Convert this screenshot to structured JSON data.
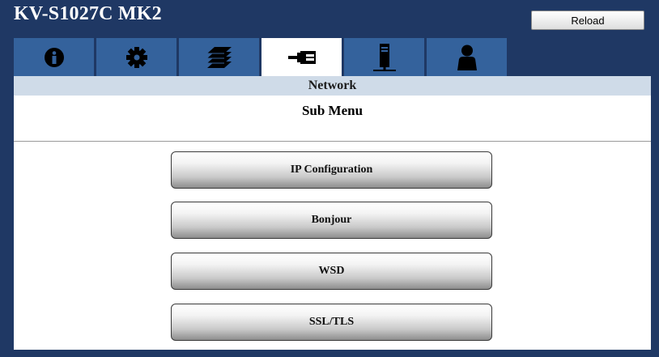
{
  "app": {
    "title": "KV-S1027C MK2"
  },
  "header": {
    "reload_label": "Reload"
  },
  "tabs": [
    {
      "icon": "info-icon",
      "active": false
    },
    {
      "icon": "gear-icon",
      "active": false
    },
    {
      "icon": "paper-stack-icon",
      "active": false
    },
    {
      "icon": "network-plug-icon",
      "active": true
    },
    {
      "icon": "server-tower-icon",
      "active": false
    },
    {
      "icon": "user-icon",
      "active": false
    }
  ],
  "section": {
    "title": "Network"
  },
  "submenu": {
    "title": "Sub Menu",
    "items": [
      {
        "label": "IP Configuration"
      },
      {
        "label": "Bonjour"
      },
      {
        "label": "WSD"
      },
      {
        "label": "SSL/TLS"
      }
    ]
  },
  "colors": {
    "frame": "#1f3864",
    "tab": "#34629c",
    "tab_active": "#ffffff",
    "section_bar": "#cfdbe8"
  }
}
